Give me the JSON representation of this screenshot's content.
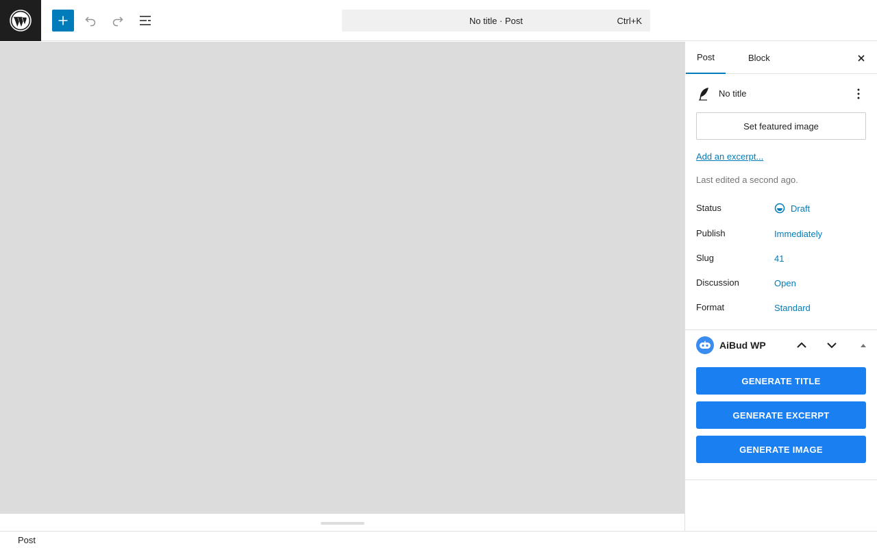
{
  "toolbar": {
    "logo_icon": "wordpress-logo-icon",
    "add_icon": "plus-icon",
    "undo_icon": "undo-icon",
    "redo_icon": "redo-icon",
    "list_view_icon": "list-view-icon"
  },
  "command_bar": {
    "title": "No title · Post",
    "shortcut": "Ctrl+K"
  },
  "sidebar": {
    "tabs": [
      {
        "label": "Post",
        "active": true
      },
      {
        "label": "Block",
        "active": false
      }
    ],
    "post_title": "No title",
    "featured_image_label": "Set featured image",
    "excerpt_link": "Add an excerpt...",
    "last_edited": "Last edited a second ago.",
    "rows": [
      {
        "label": "Status",
        "value": "Draft"
      },
      {
        "label": "Publish",
        "value": "Immediately"
      },
      {
        "label": "Slug",
        "value": "41"
      },
      {
        "label": "Discussion",
        "value": "Open"
      },
      {
        "label": "Format",
        "value": "Standard"
      }
    ],
    "aibud": {
      "title": "AiBud WP",
      "buttons": [
        "GENERATE TITLE",
        "GENERATE EXCERPT",
        "GENERATE IMAGE"
      ]
    }
  },
  "footer": {
    "breadcrumb": "Post"
  },
  "colors": {
    "accent": "#007cba",
    "aibud_button": "#1a7ff0",
    "canvas": "#dcdcdc"
  }
}
